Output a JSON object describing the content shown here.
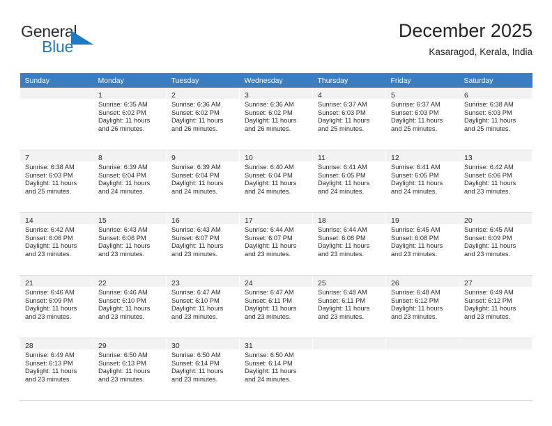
{
  "logo": {
    "text_general": "General",
    "text_blue": "Blue",
    "triangle_color": "#1f7ac4",
    "blue_color": "#1f7ac4",
    "general_color": "#2b2b2b"
  },
  "header": {
    "title": "December 2025",
    "subtitle": "Kasaragod, Kerala, India"
  },
  "theme": {
    "header_bg": "#3b7dc0",
    "daynum_bg": "#f2f2f2",
    "row_divider": "#dcdcdc",
    "text": "#2b2b2b"
  },
  "weekdays": [
    "Sunday",
    "Monday",
    "Tuesday",
    "Wednesday",
    "Thursday",
    "Friday",
    "Saturday"
  ],
  "labels": {
    "sunrise_prefix": "Sunrise:",
    "sunset_prefix": "Sunset:",
    "daylight_prefix": "Daylight:"
  },
  "weeks": [
    [
      {
        "empty": true
      },
      {
        "day": "1",
        "sunrise": "Sunrise: 6:35 AM",
        "sunset": "Sunset: 6:02 PM",
        "daylight1": "Daylight: 11 hours",
        "daylight2": "and 26 minutes."
      },
      {
        "day": "2",
        "sunrise": "Sunrise: 6:36 AM",
        "sunset": "Sunset: 6:02 PM",
        "daylight1": "Daylight: 11 hours",
        "daylight2": "and 26 minutes."
      },
      {
        "day": "3",
        "sunrise": "Sunrise: 6:36 AM",
        "sunset": "Sunset: 6:02 PM",
        "daylight1": "Daylight: 11 hours",
        "daylight2": "and 26 minutes."
      },
      {
        "day": "4",
        "sunrise": "Sunrise: 6:37 AM",
        "sunset": "Sunset: 6:03 PM",
        "daylight1": "Daylight: 11 hours",
        "daylight2": "and 25 minutes."
      },
      {
        "day": "5",
        "sunrise": "Sunrise: 6:37 AM",
        "sunset": "Sunset: 6:03 PM",
        "daylight1": "Daylight: 11 hours",
        "daylight2": "and 25 minutes."
      },
      {
        "day": "6",
        "sunrise": "Sunrise: 6:38 AM",
        "sunset": "Sunset: 6:03 PM",
        "daylight1": "Daylight: 11 hours",
        "daylight2": "and 25 minutes."
      }
    ],
    [
      {
        "day": "7",
        "sunrise": "Sunrise: 6:38 AM",
        "sunset": "Sunset: 6:03 PM",
        "daylight1": "Daylight: 11 hours",
        "daylight2": "and 25 minutes."
      },
      {
        "day": "8",
        "sunrise": "Sunrise: 6:39 AM",
        "sunset": "Sunset: 6:04 PM",
        "daylight1": "Daylight: 11 hours",
        "daylight2": "and 24 minutes."
      },
      {
        "day": "9",
        "sunrise": "Sunrise: 6:39 AM",
        "sunset": "Sunset: 6:04 PM",
        "daylight1": "Daylight: 11 hours",
        "daylight2": "and 24 minutes."
      },
      {
        "day": "10",
        "sunrise": "Sunrise: 6:40 AM",
        "sunset": "Sunset: 6:04 PM",
        "daylight1": "Daylight: 11 hours",
        "daylight2": "and 24 minutes."
      },
      {
        "day": "11",
        "sunrise": "Sunrise: 6:41 AM",
        "sunset": "Sunset: 6:05 PM",
        "daylight1": "Daylight: 11 hours",
        "daylight2": "and 24 minutes."
      },
      {
        "day": "12",
        "sunrise": "Sunrise: 6:41 AM",
        "sunset": "Sunset: 6:05 PM",
        "daylight1": "Daylight: 11 hours",
        "daylight2": "and 24 minutes."
      },
      {
        "day": "13",
        "sunrise": "Sunrise: 6:42 AM",
        "sunset": "Sunset: 6:06 PM",
        "daylight1": "Daylight: 11 hours",
        "daylight2": "and 23 minutes."
      }
    ],
    [
      {
        "day": "14",
        "sunrise": "Sunrise: 6:42 AM",
        "sunset": "Sunset: 6:06 PM",
        "daylight1": "Daylight: 11 hours",
        "daylight2": "and 23 minutes."
      },
      {
        "day": "15",
        "sunrise": "Sunrise: 6:43 AM",
        "sunset": "Sunset: 6:06 PM",
        "daylight1": "Daylight: 11 hours",
        "daylight2": "and 23 minutes."
      },
      {
        "day": "16",
        "sunrise": "Sunrise: 6:43 AM",
        "sunset": "Sunset: 6:07 PM",
        "daylight1": "Daylight: 11 hours",
        "daylight2": "and 23 minutes."
      },
      {
        "day": "17",
        "sunrise": "Sunrise: 6:44 AM",
        "sunset": "Sunset: 6:07 PM",
        "daylight1": "Daylight: 11 hours",
        "daylight2": "and 23 minutes."
      },
      {
        "day": "18",
        "sunrise": "Sunrise: 6:44 AM",
        "sunset": "Sunset: 6:08 PM",
        "daylight1": "Daylight: 11 hours",
        "daylight2": "and 23 minutes."
      },
      {
        "day": "19",
        "sunrise": "Sunrise: 6:45 AM",
        "sunset": "Sunset: 6:08 PM",
        "daylight1": "Daylight: 11 hours",
        "daylight2": "and 23 minutes."
      },
      {
        "day": "20",
        "sunrise": "Sunrise: 6:45 AM",
        "sunset": "Sunset: 6:09 PM",
        "daylight1": "Daylight: 11 hours",
        "daylight2": "and 23 minutes."
      }
    ],
    [
      {
        "day": "21",
        "sunrise": "Sunrise: 6:46 AM",
        "sunset": "Sunset: 6:09 PM",
        "daylight1": "Daylight: 11 hours",
        "daylight2": "and 23 minutes."
      },
      {
        "day": "22",
        "sunrise": "Sunrise: 6:46 AM",
        "sunset": "Sunset: 6:10 PM",
        "daylight1": "Daylight: 11 hours",
        "daylight2": "and 23 minutes."
      },
      {
        "day": "23",
        "sunrise": "Sunrise: 6:47 AM",
        "sunset": "Sunset: 6:10 PM",
        "daylight1": "Daylight: 11 hours",
        "daylight2": "and 23 minutes."
      },
      {
        "day": "24",
        "sunrise": "Sunrise: 6:47 AM",
        "sunset": "Sunset: 6:11 PM",
        "daylight1": "Daylight: 11 hours",
        "daylight2": "and 23 minutes."
      },
      {
        "day": "25",
        "sunrise": "Sunrise: 6:48 AM",
        "sunset": "Sunset: 6:11 PM",
        "daylight1": "Daylight: 11 hours",
        "daylight2": "and 23 minutes."
      },
      {
        "day": "26",
        "sunrise": "Sunrise: 6:48 AM",
        "sunset": "Sunset: 6:12 PM",
        "daylight1": "Daylight: 11 hours",
        "daylight2": "and 23 minutes."
      },
      {
        "day": "27",
        "sunrise": "Sunrise: 6:49 AM",
        "sunset": "Sunset: 6:12 PM",
        "daylight1": "Daylight: 11 hours",
        "daylight2": "and 23 minutes."
      }
    ],
    [
      {
        "day": "28",
        "sunrise": "Sunrise: 6:49 AM",
        "sunset": "Sunset: 6:13 PM",
        "daylight1": "Daylight: 11 hours",
        "daylight2": "and 23 minutes."
      },
      {
        "day": "29",
        "sunrise": "Sunrise: 6:50 AM",
        "sunset": "Sunset: 6:13 PM",
        "daylight1": "Daylight: 11 hours",
        "daylight2": "and 23 minutes."
      },
      {
        "day": "30",
        "sunrise": "Sunrise: 6:50 AM",
        "sunset": "Sunset: 6:14 PM",
        "daylight1": "Daylight: 11 hours",
        "daylight2": "and 23 minutes."
      },
      {
        "day": "31",
        "sunrise": "Sunrise: 6:50 AM",
        "sunset": "Sunset: 6:14 PM",
        "daylight1": "Daylight: 11 hours",
        "daylight2": "and 24 minutes."
      },
      {
        "empty": true
      },
      {
        "empty": true
      },
      {
        "empty": true
      }
    ]
  ]
}
